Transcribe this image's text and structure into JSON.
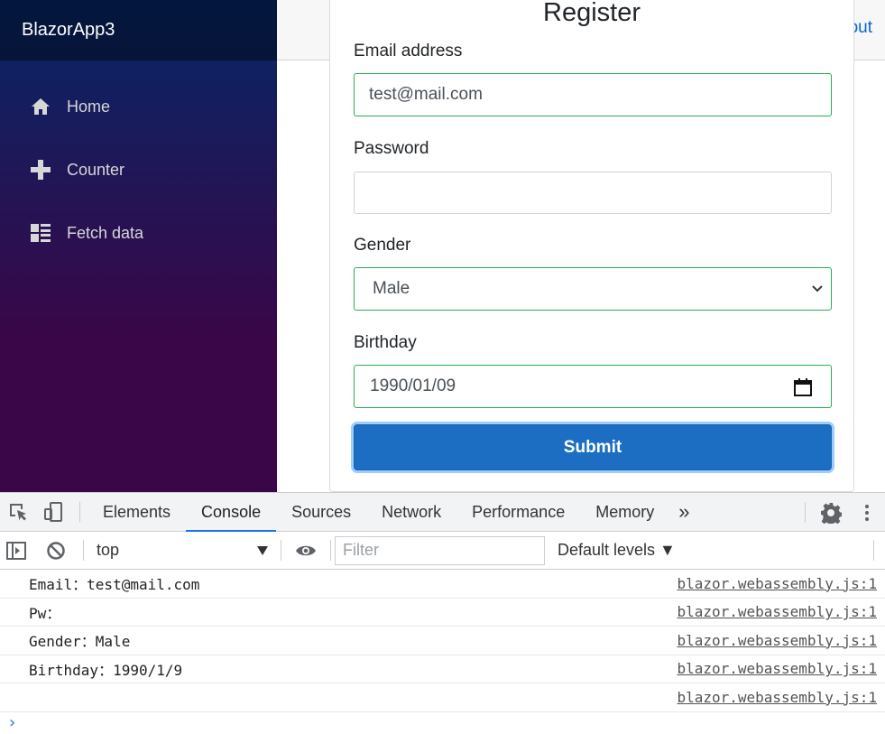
{
  "app": {
    "brand": "BlazorApp3",
    "nav": [
      {
        "label": "Home",
        "icon": "home-icon"
      },
      {
        "label": "Counter",
        "icon": "plus-icon"
      },
      {
        "label": "Fetch data",
        "icon": "list-icon"
      }
    ],
    "top_link": "out"
  },
  "form": {
    "title": "Register",
    "email_label": "Email address",
    "email_value": "test@mail.com",
    "password_label": "Password",
    "password_value": "",
    "gender_label": "Gender",
    "gender_value": "Male",
    "birthday_label": "Birthday",
    "birthday_value": "1990/01/09",
    "submit_label": "Submit",
    "valid_color": "#26b050",
    "submit_color": "#1b6ec2"
  },
  "devtools": {
    "tabs": [
      "Elements",
      "Console",
      "Sources",
      "Network",
      "Performance",
      "Memory"
    ],
    "active_tab": "Console",
    "more": "»",
    "context": "top",
    "filter_placeholder": "Filter",
    "levels": "Default levels ▼",
    "logs": [
      {
        "message": "Email：test@mail.com",
        "source": "blazor.webassembly.js:1"
      },
      {
        "message": "Pw：",
        "source": "blazor.webassembly.js:1"
      },
      {
        "message": "Gender：Male",
        "source": "blazor.webassembly.js:1"
      },
      {
        "message": "Birthday：1990/1/9",
        "source": "blazor.webassembly.js:1"
      },
      {
        "message": "",
        "source": "blazor.webassembly.js:1"
      }
    ],
    "prompt": "›"
  }
}
